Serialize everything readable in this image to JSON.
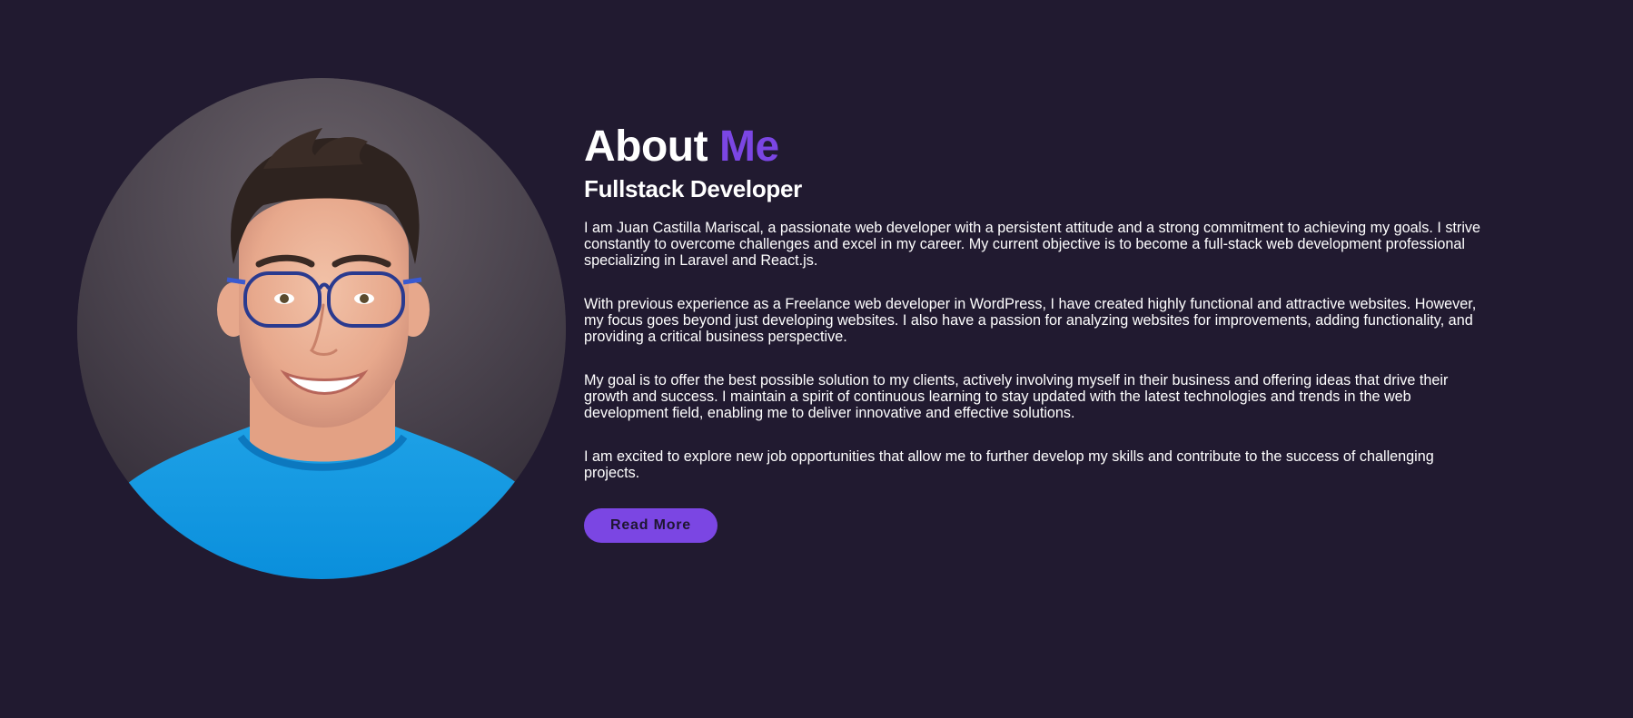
{
  "about": {
    "title_main": "About",
    "title_accent": "Me",
    "subtitle": "Fullstack Developer",
    "paragraphs": [
      "I am Juan Castilla Mariscal, a passionate web developer with a persistent attitude and a strong commitment to achieving my goals. I strive constantly to overcome challenges and excel in my career. My current objective is to become a full-stack web development professional specializing in Laravel and React.js.",
      "With previous experience as a Freelance web developer in WordPress, I have created highly functional and attractive websites. However, my focus goes beyond just developing websites. I also have a passion for analyzing websites for improvements, adding functionality, and providing a critical business perspective.",
      "My goal is to offer the best possible solution to my clients, actively involving myself in their business and offering ideas that drive their growth and success. I maintain a spirit of continuous learning to stay updated with the latest technologies and trends in the web development field, enabling me to deliver innovative and effective solutions.",
      "I am excited to explore new job opportunities that allow me to further develop my skills and contribute to the success of challenging projects."
    ],
    "button_label": "Read More"
  },
  "colors": {
    "background": "#211a30",
    "accent": "#7b46e3",
    "text": "#ffffff"
  }
}
